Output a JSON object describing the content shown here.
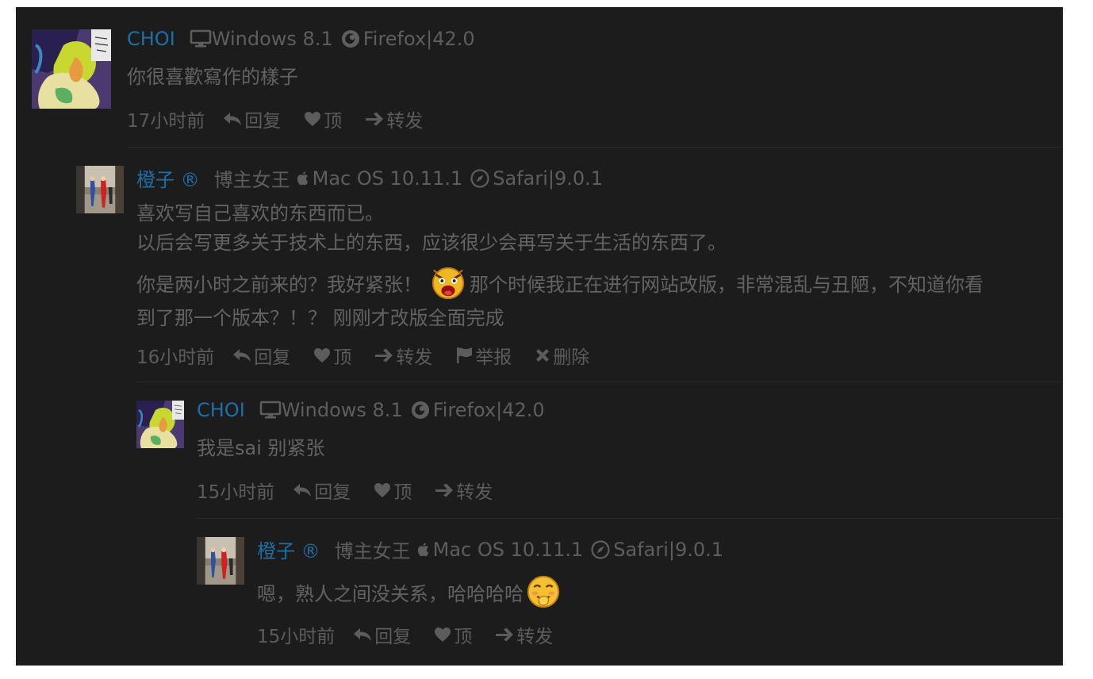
{
  "comments": [
    {
      "author": "CHOI",
      "os": "Windows 8.1",
      "browser": "Firefox|42.0",
      "text": [
        "你很喜歡寫作的樣子"
      ],
      "time": "17小时前",
      "actions": {
        "reply": "回复",
        "like": "顶",
        "share": "转发"
      }
    },
    {
      "author": "橙子 ®",
      "role": "博主女王",
      "os": "Mac OS 10.11.1",
      "browser": "Safari|9.0.1",
      "text": [
        "喜欢写自己喜欢的东西而已。",
        "以后会写更多关于技术上的东西，应该很少会再写关于生活的东西了。",
        "你是两小时之前来的？我好紧张！",
        "那个时候我正在进行网站改版，非常混乱与丑陋，不知道你看",
        "到了那一个版本？！？ 刚刚才改版全面完成"
      ],
      "time": "16小时前",
      "actions": {
        "reply": "回复",
        "like": "顶",
        "share": "转发",
        "report": "举报",
        "delete": "删除"
      }
    },
    {
      "author": "CHOI",
      "os": "Windows 8.1",
      "browser": "Firefox|42.0",
      "text": [
        "我是sai 别紧张"
      ],
      "time": "15小时前",
      "actions": {
        "reply": "回复",
        "like": "顶",
        "share": "转发"
      }
    },
    {
      "author": "橙子 ®",
      "role": "博主女王",
      "os": "Mac OS 10.11.1",
      "browser": "Safari|9.0.1",
      "text": [
        "嗯，熟人之间没关系，哈哈哈哈"
      ],
      "time": "15小时前",
      "actions": {
        "reply": "回复",
        "like": "顶",
        "share": "转发"
      }
    }
  ],
  "icons": {
    "os_windows": "monitor-icon",
    "os_mac": "apple-icon",
    "browser_firefox": "firefox-icon",
    "browser_safari": "safari-compass-icon",
    "reply": "reply-arrow-icon",
    "like": "heart-icon",
    "share": "share-arrow-icon",
    "report": "flag-icon",
    "delete": "close-x-icon",
    "emoji_1": "shocked-face-emoji",
    "emoji_2": "giggle-face-emoji"
  },
  "colors": {
    "background": "#1c1c1c",
    "author": "#1e6fa8",
    "text": "#636363",
    "meta": "#5e5e5e"
  }
}
